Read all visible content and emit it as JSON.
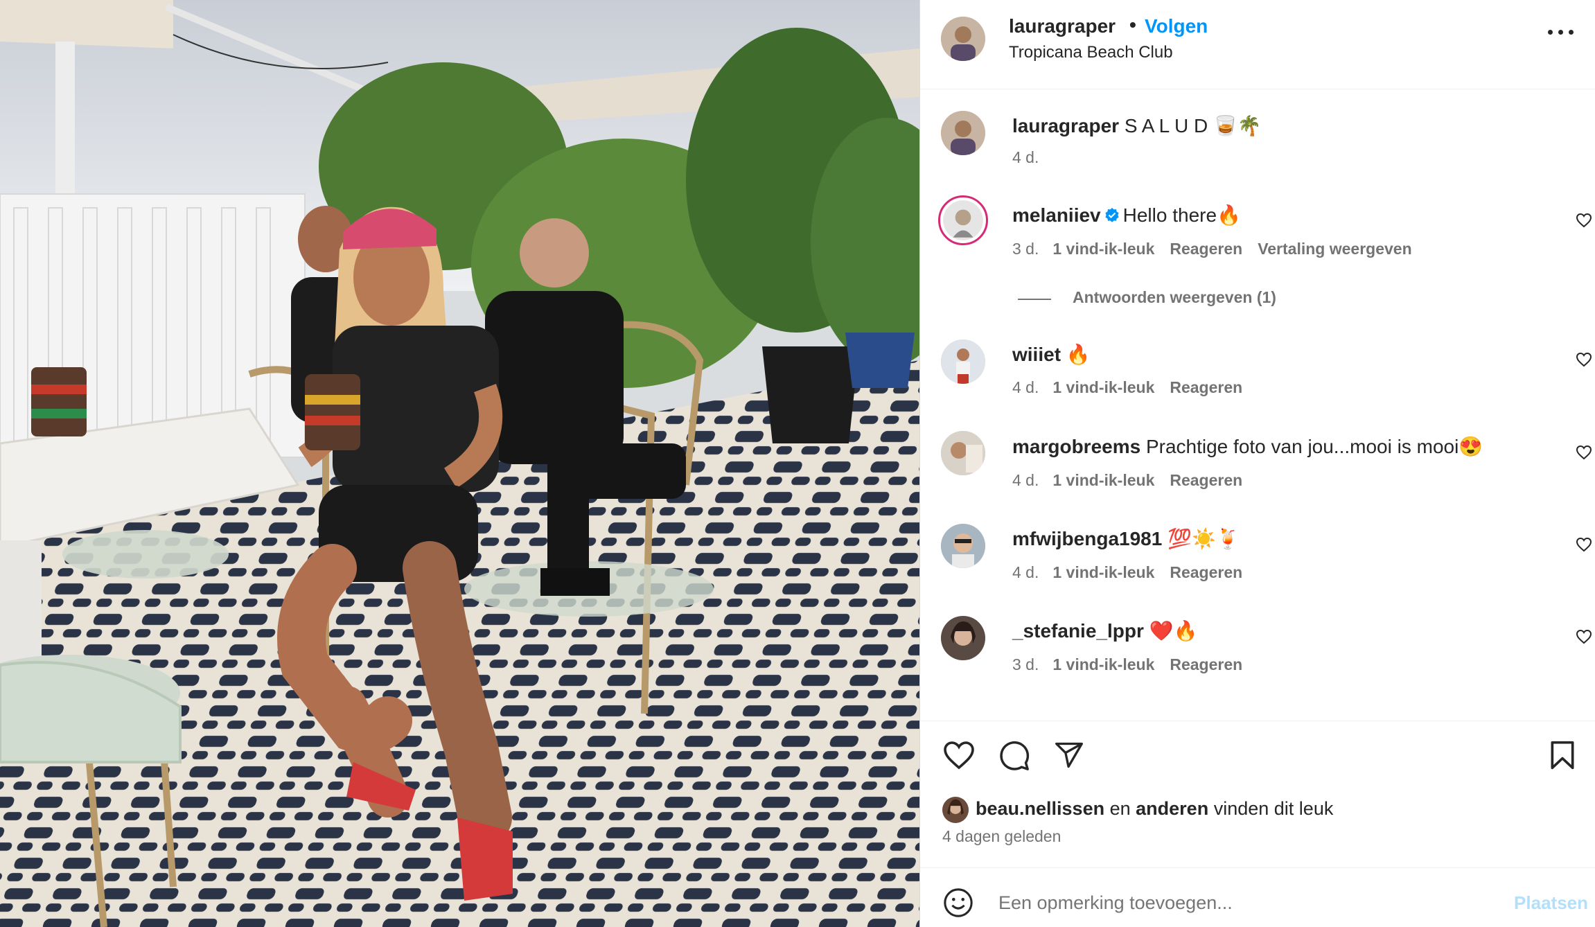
{
  "post": {
    "author": "lauragraper",
    "separator_dot": "•",
    "follow_label": "Volgen",
    "location": "Tropicana Beach Club",
    "caption": "S A L U D 🥃🌴",
    "caption_time": "4 d."
  },
  "comments": [
    {
      "user": "melaniiev",
      "verified": true,
      "text": "Hello there🔥",
      "time": "3 d.",
      "likes": "1 vind-ik-leuk",
      "reply": "Reageren",
      "translate": "Vertaling weergeven",
      "view_replies": "Antwoorden weergeven (1)"
    },
    {
      "user": "wiiiet",
      "text": "🔥",
      "time": "4 d.",
      "likes": "1 vind-ik-leuk",
      "reply": "Reageren"
    },
    {
      "user": "margobreems",
      "text": "Prachtige foto van jou...mooi is mooi😍",
      "time": "4 d.",
      "likes": "1 vind-ik-leuk",
      "reply": "Reageren"
    },
    {
      "user": "mfwijbenga1981",
      "text": "💯☀️🍹",
      "time": "4 d.",
      "likes": "1 vind-ik-leuk",
      "reply": "Reageren"
    },
    {
      "user": "_stefanie_lppr",
      "text": "❤️🔥",
      "time": "3 d.",
      "likes": "1 vind-ik-leuk",
      "reply": "Reageren"
    }
  ],
  "likes_summary": {
    "first_user": "beau.nellissen",
    "and_text": "en",
    "others": "anderen",
    "suffix": "vinden dit leuk"
  },
  "posted_ago": "4 dagen geleden",
  "comment_box": {
    "placeholder": "Een opmerking toevoegen...",
    "post_label": "Plaatsen"
  },
  "icons": {
    "more": "more-options-icon",
    "like": "heart-icon",
    "comment": "comment-icon",
    "share": "send-icon",
    "save": "bookmark-icon",
    "emoji": "emoji-icon",
    "verified": "verified-badge-icon"
  },
  "colors": {
    "link_blue": "#0095f6",
    "muted": "#737373",
    "text": "#262626",
    "post_disabled": "#b2dffc",
    "verified": "#0095f6"
  }
}
